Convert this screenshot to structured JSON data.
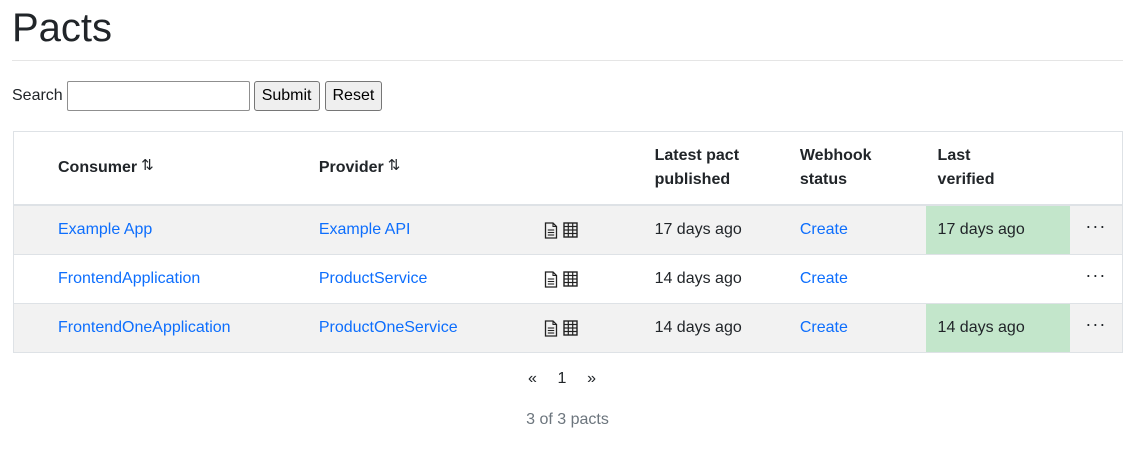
{
  "page": {
    "title": "Pacts"
  },
  "search": {
    "label": "Search",
    "value": "",
    "placeholder": "",
    "submit_label": "Submit",
    "reset_label": "Reset"
  },
  "table": {
    "headers": {
      "consumer": "Consumer",
      "provider": "Provider",
      "published_line1": "Latest pact",
      "published_line2": "published",
      "webhook_line1": "Webhook",
      "webhook_line2": "status",
      "verified_line1": "Last",
      "verified_line2": "verified",
      "sort_icon": "⇅"
    },
    "rows": [
      {
        "consumer": "Example App",
        "provider": "Example API",
        "published": "17 days ago",
        "webhook": "Create",
        "verified": "17 days ago",
        "verified_status": "success",
        "actions": "···"
      },
      {
        "consumer": "FrontendApplication",
        "provider": "ProductService",
        "published": "14 days ago",
        "webhook": "Create",
        "verified": "",
        "verified_status": "none",
        "actions": "···"
      },
      {
        "consumer": "FrontendOneApplication",
        "provider": "ProductOneService",
        "published": "14 days ago",
        "webhook": "Create",
        "verified": "14 days ago",
        "verified_status": "success",
        "actions": "···"
      }
    ]
  },
  "pagination": {
    "prev": "«",
    "current": "1",
    "next": "»"
  },
  "summary": {
    "count_text": "3 of 3 pacts"
  },
  "colors": {
    "link": "#0d6efd",
    "verified_success": "#c3e6cb",
    "row_stripe": "#f2f2f2"
  },
  "icons": {
    "pact_doc": "document-icon",
    "pact_matrix": "matrix-grid-icon",
    "row_menu": "more-horizontal-icon"
  }
}
